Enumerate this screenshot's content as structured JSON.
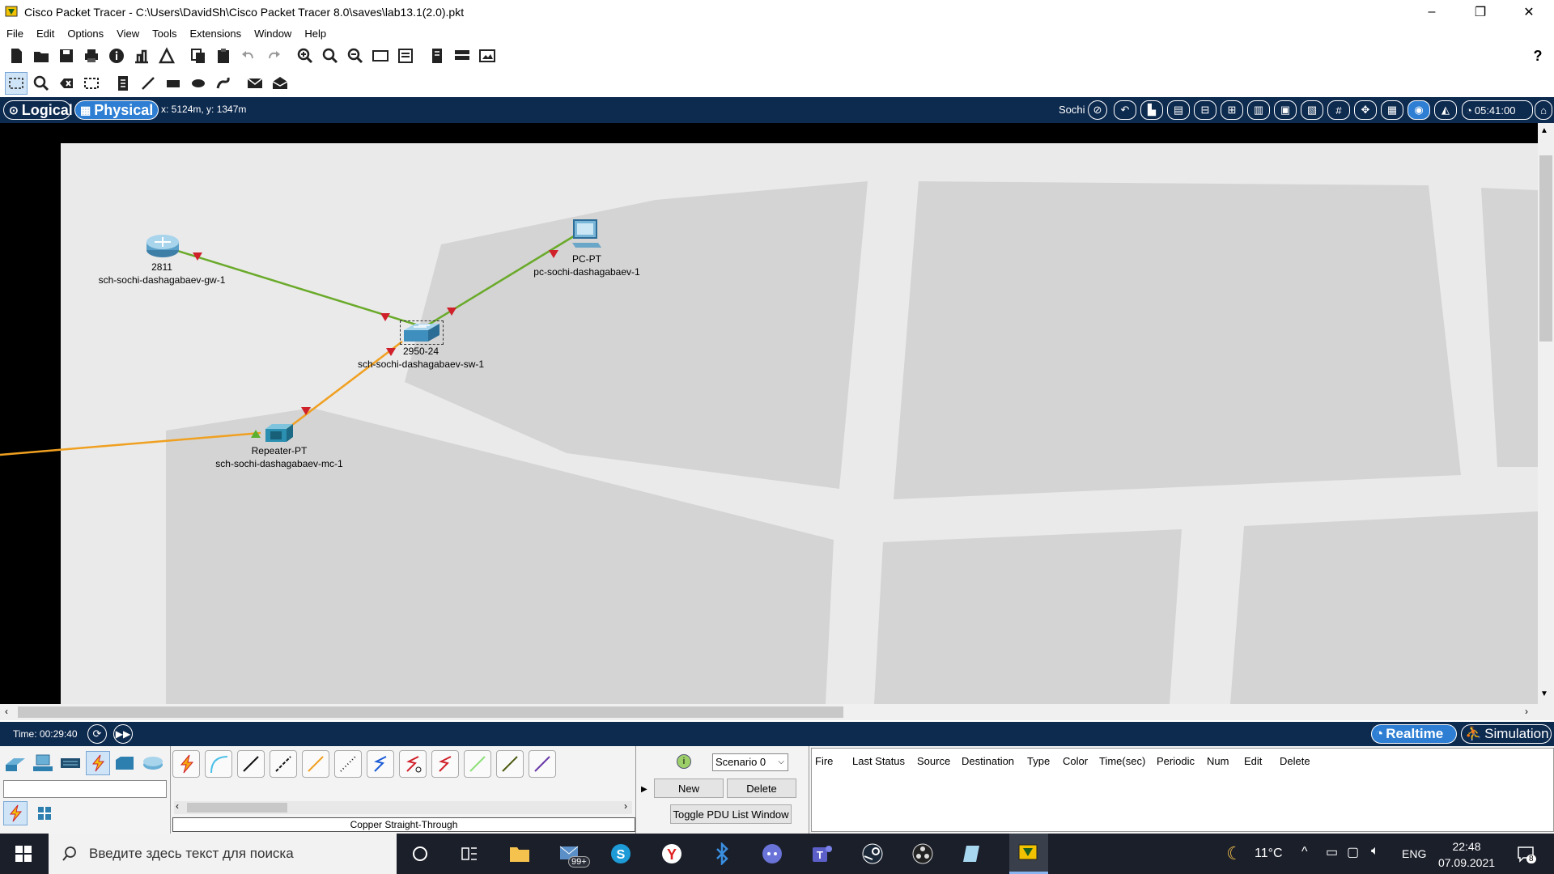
{
  "window": {
    "title": "Cisco Packet Tracer - C:\\Users\\DavidSh\\Cisco Packet Tracer 8.0\\saves\\lab13.1(2.0).pkt",
    "minimize": "–",
    "restore": "❐",
    "close": "✕"
  },
  "menu": [
    "File",
    "Edit",
    "Options",
    "View",
    "Tools",
    "Extensions",
    "Window",
    "Help"
  ],
  "help_icon": "?",
  "navbar": {
    "logical_label": "Logical",
    "physical_label": "Physical",
    "coords": "x: 5124m, y: 1347m",
    "location": "Sochi",
    "clock": "05:41:00"
  },
  "devices": [
    {
      "model": "2811",
      "name": "sch-sochi-dashagabaev-gw-1",
      "kind": "router"
    },
    {
      "model": "PC-PT",
      "name": "pc-sochi-dashagabaev-1",
      "kind": "pc"
    },
    {
      "model": "2950-24",
      "name": "sch-sochi-dashagabaev-sw-1",
      "kind": "switch"
    },
    {
      "model": "Repeater-PT",
      "name": "sch-sochi-dashagabaev-mc-1",
      "kind": "repeater"
    }
  ],
  "colors": {
    "navbar_bg": "#0d2a4f",
    "link_green": "#6aaa2a",
    "link_orange": "#f0a020",
    "link_down": "#d0202a",
    "link_up": "#5ab030",
    "map_bg": "#eaeaea",
    "building": "#d4d4d4"
  },
  "timebar": {
    "time": "Time: 00:29:40",
    "realtime_label": "Realtime",
    "simulation_label": "Simulation"
  },
  "bottom": {
    "cable_caption": "Copper Straight-Through",
    "scenario_selected": "Scenario 0",
    "new_label": "New",
    "delete_label": "Delete",
    "toggle_label": "Toggle PDU List Window",
    "pdu_columns": [
      "Fire",
      "Last Status",
      "Source",
      "Destination",
      "Type",
      "Color",
      "Time(sec)",
      "Periodic",
      "Num",
      "Edit",
      "Delete"
    ]
  },
  "taskbar": {
    "search_placeholder": "Введите здесь текст для поиска",
    "mail_badge": "99+",
    "weather": "11°C",
    "language": "ENG",
    "time": "22:48",
    "date": "07.09.2021",
    "notification_count": "8"
  }
}
